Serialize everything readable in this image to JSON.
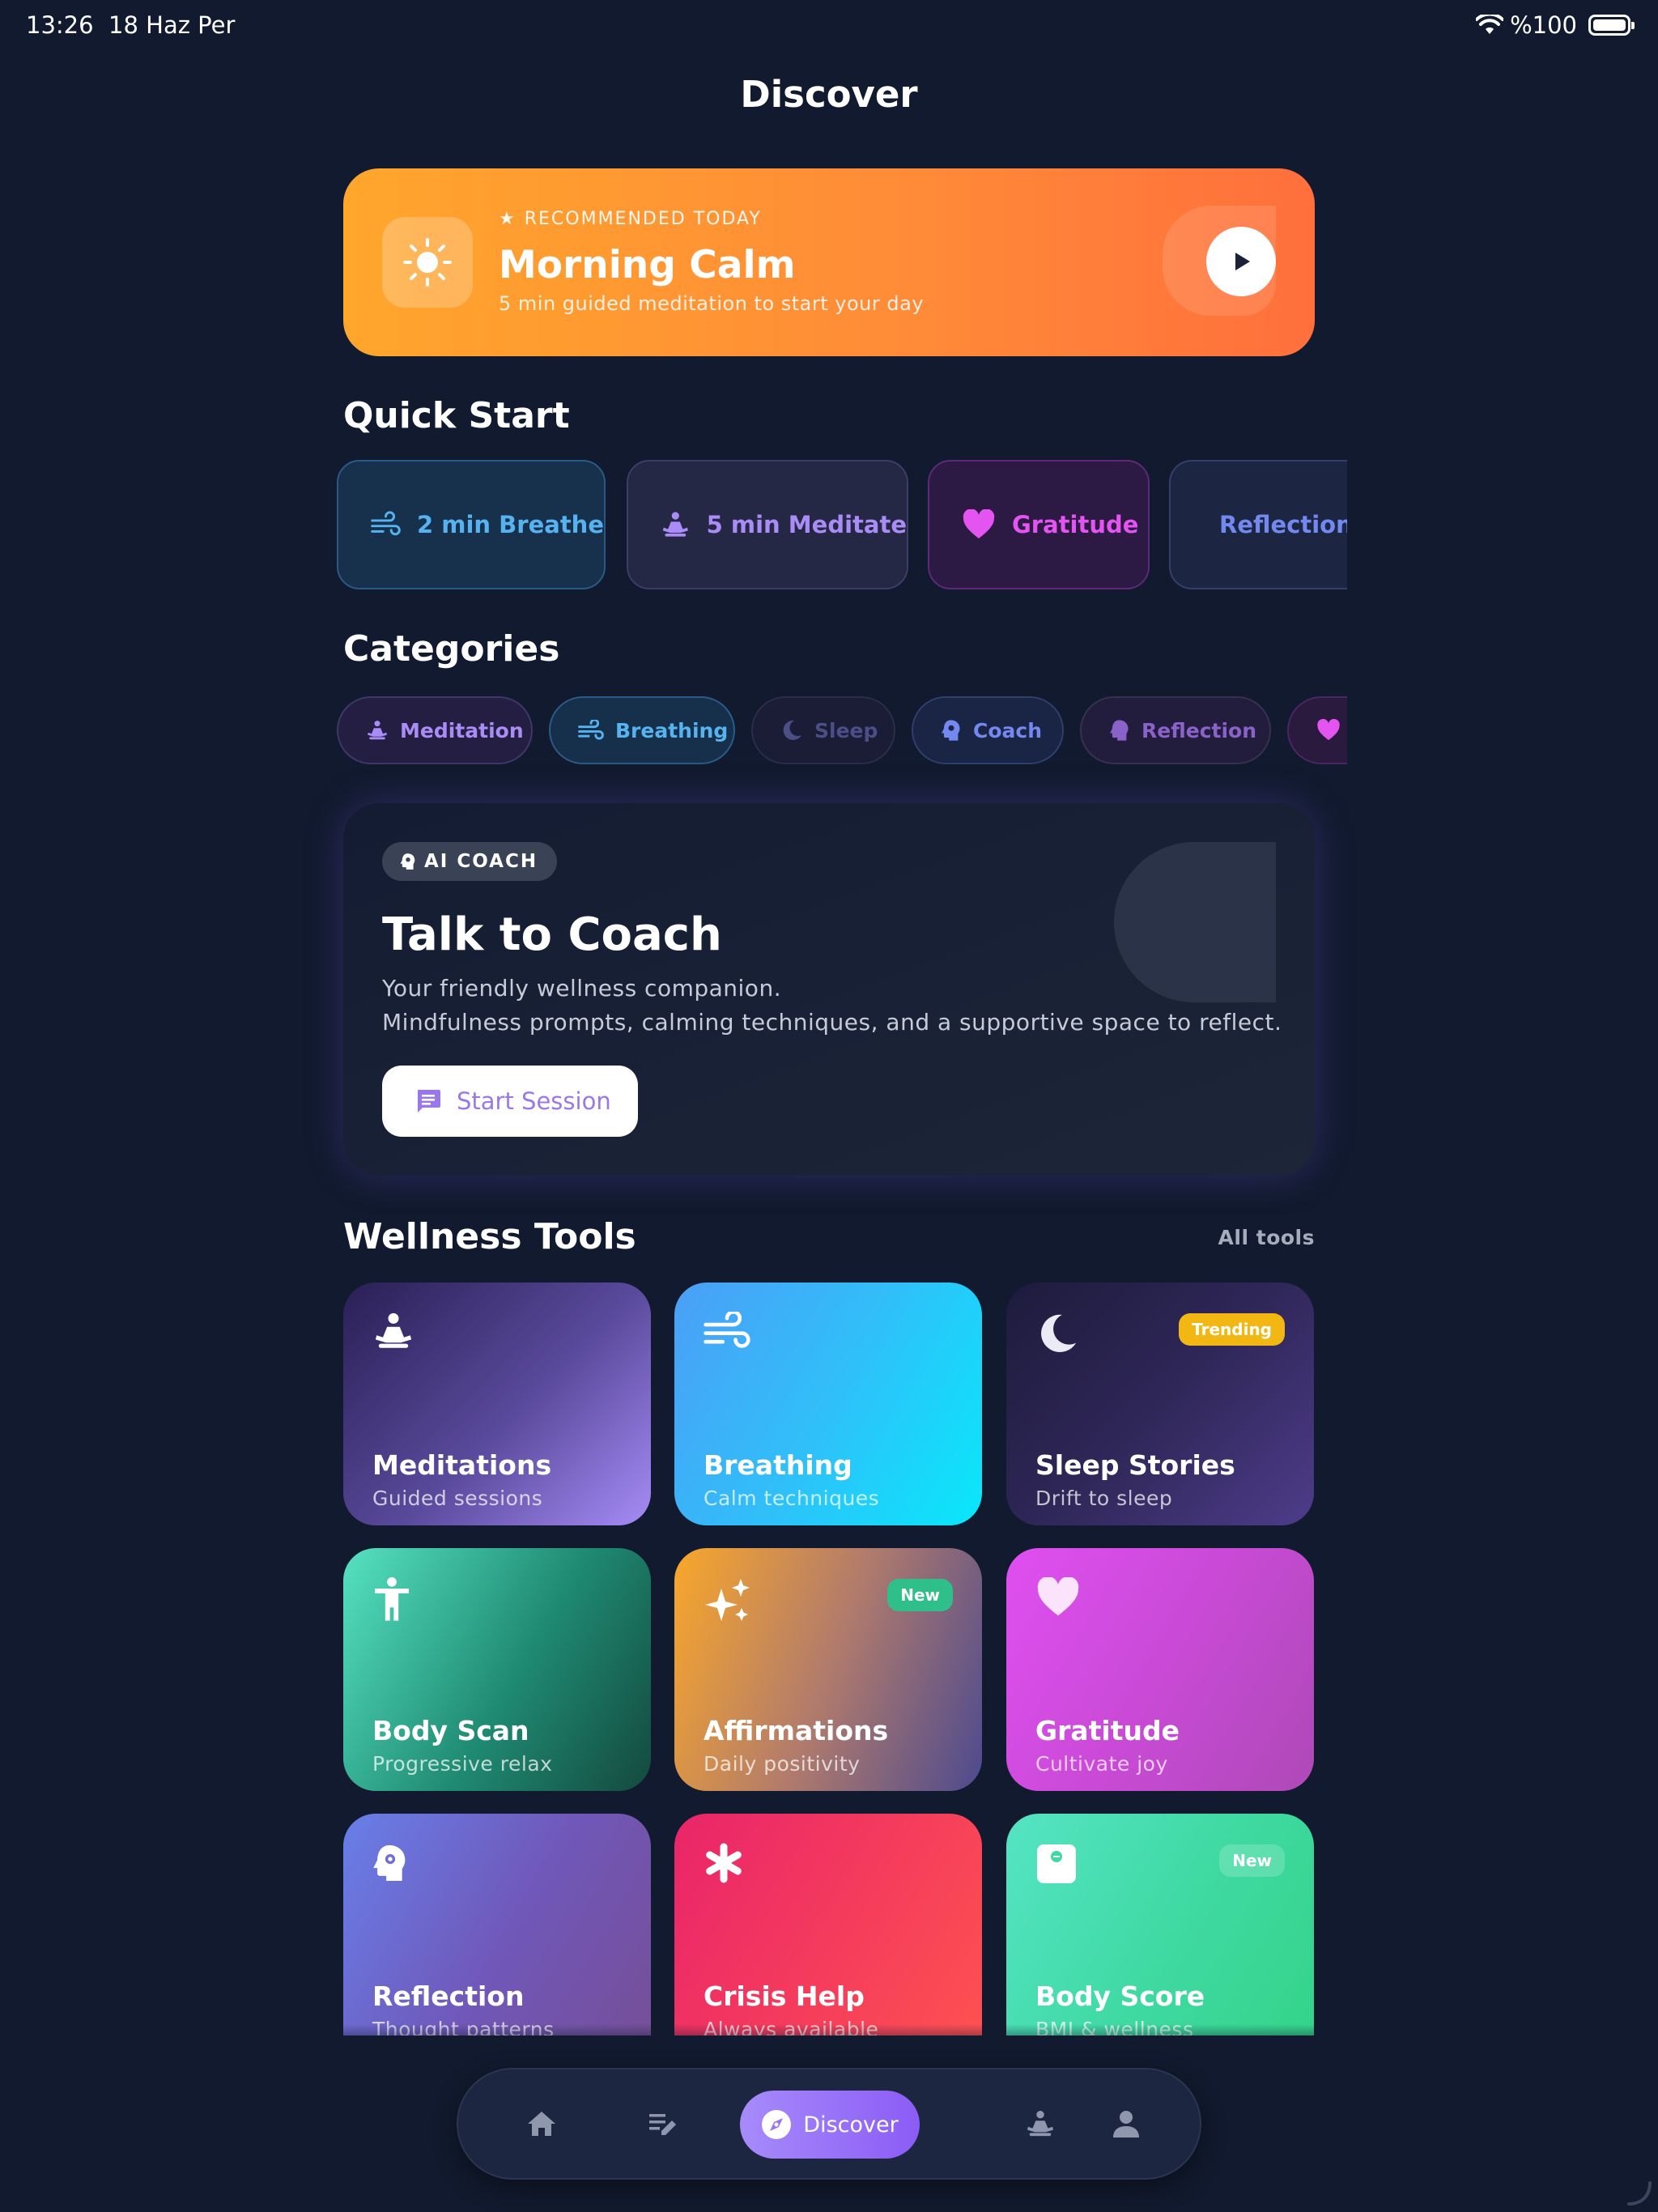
{
  "status_bar": {
    "time": "13:26",
    "date": "18 Haz Per",
    "battery": "%100"
  },
  "page": {
    "title": "Discover"
  },
  "hero": {
    "eyebrow": "RECOMMENDED TODAY",
    "title": "Morning Calm",
    "subtitle": "5 min guided meditation to start your day",
    "icon": "sun-icon"
  },
  "quick_start": {
    "title": "Quick Start",
    "items": [
      {
        "label": "2 min Breathe",
        "icon": "wind-icon"
      },
      {
        "label": "5 min Meditate",
        "icon": "meditation-icon"
      },
      {
        "label": "Gratitude",
        "icon": "heart-icon"
      },
      {
        "label": "Reflection",
        "icon": "brain-gear-icon"
      }
    ]
  },
  "categories": {
    "title": "Categories",
    "items": [
      {
        "label": "Meditation",
        "icon": "meditation-icon"
      },
      {
        "label": "Breathing",
        "icon": "wind-icon"
      },
      {
        "label": "Sleep",
        "icon": "moon-icon"
      },
      {
        "label": "Coach",
        "icon": "brain-gear-icon"
      },
      {
        "label": "Reflection",
        "icon": "head-icon"
      },
      {
        "label": "",
        "icon": "heart-icon"
      }
    ]
  },
  "coach": {
    "badge": "AI COACH",
    "title": "Talk to Coach",
    "desc1": "Your friendly wellness companion.",
    "desc2": "Mindfulness prompts, calming techniques, and a supportive space to reflect.",
    "button": "Start Session"
  },
  "wellness_tools": {
    "title": "Wellness Tools",
    "all_link": "All tools",
    "items": [
      {
        "title": "Meditations",
        "subtitle": "Guided sessions",
        "icon": "meditation-icon",
        "badge": ""
      },
      {
        "title": "Breathing",
        "subtitle": "Calm techniques",
        "icon": "wind-icon",
        "badge": ""
      },
      {
        "title": "Sleep Stories",
        "subtitle": "Drift to sleep",
        "icon": "moon-icon",
        "badge": "Trending"
      },
      {
        "title": "Body Scan",
        "subtitle": "Progressive relax",
        "icon": "accessibility-icon",
        "badge": ""
      },
      {
        "title": "Affirmations",
        "subtitle": "Daily positivity",
        "icon": "sparkles-icon",
        "badge": "New"
      },
      {
        "title": "Gratitude",
        "subtitle": "Cultivate joy",
        "icon": "heart-icon",
        "badge": ""
      },
      {
        "title": "Reflection",
        "subtitle": "Thought patterns",
        "icon": "brain-gear-icon",
        "badge": ""
      },
      {
        "title": "Crisis Help",
        "subtitle": "Always available",
        "icon": "asterisk-icon",
        "badge": ""
      },
      {
        "title": "Body Score",
        "subtitle": "BMI & wellness",
        "icon": "scale-icon",
        "badge": "New"
      }
    ]
  },
  "nav": {
    "items": [
      {
        "icon": "home-icon"
      },
      {
        "icon": "journal-icon"
      },
      {
        "icon": "compass-icon",
        "label": "Discover",
        "active": true
      },
      {
        "icon": "meditation-icon"
      },
      {
        "icon": "person-icon"
      }
    ]
  },
  "colors": {
    "background": "#111a2e",
    "accent": "#8b5cf6",
    "hero_start": "#ffa62c",
    "hero_end": "#ff6f3c",
    "trending_badge": "#f2b713",
    "new_badge": "#2fbf8a"
  }
}
